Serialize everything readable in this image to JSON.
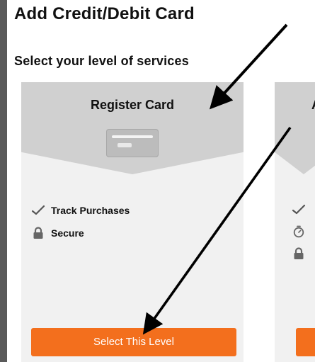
{
  "page": {
    "title": "Add Credit/Debit Card",
    "subtitle": "Select your level of services"
  },
  "cards": [
    {
      "title": "Register Card",
      "features": [
        {
          "icon": "check-icon",
          "label": "Track Purchases"
        },
        {
          "icon": "lock-icon",
          "label": "Secure"
        }
      ],
      "button_label": "Select This Level"
    },
    {
      "title": "A",
      "features": [
        {
          "icon": "check-icon",
          "label": ""
        },
        {
          "icon": "timer-icon",
          "label": ""
        },
        {
          "icon": "lock-icon",
          "label": ""
        }
      ],
      "button_label": ""
    }
  ],
  "colors": {
    "background": "#5a5a5a",
    "card": "#f1f1f1",
    "card_header": "#d0d0d0",
    "accent": "#f36f1d",
    "text": "#111111"
  }
}
